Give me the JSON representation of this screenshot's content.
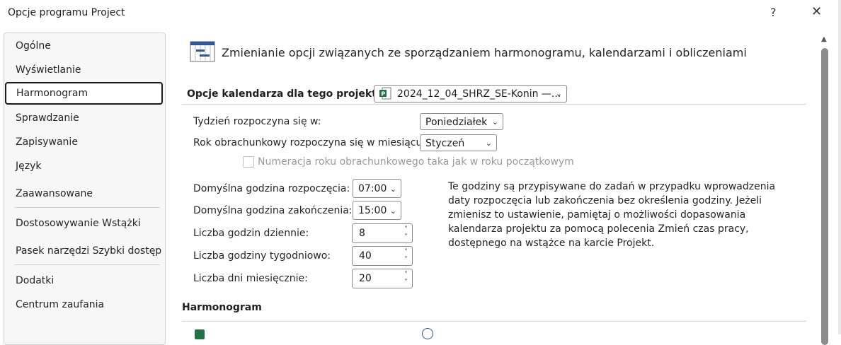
{
  "window": {
    "title": "Opcje programu Project",
    "help": "?",
    "close": "✕"
  },
  "nav": {
    "items": [
      "Ogólne",
      "Wyświetlanie",
      "Harmonogram",
      "Sprawdzanie",
      "Zapisywanie",
      "Język",
      "Zaawansowane",
      "Dostosowywanie Wstążki",
      "Pasek narzędzi Szybki dostęp",
      "Dodatki",
      "Centrum zaufania"
    ],
    "selected": "Harmonogram"
  },
  "main": {
    "heading": "Zmienianie opcji związanych ze sporządzaniem harmonogramu, kalendarzami i obliczeniami",
    "calendar_options": {
      "label": "Opcje kalendarza dla tego projektu:",
      "project_value": "2024_12_04_SHRZ_SE-Konin —...",
      "week_start_label": "Tydzień rozpoczyna się w:",
      "week_start_value": "Poniedziałek",
      "fiscal_year_label": "Rok obrachunkowy rozpoczyna się w miesiącu:",
      "fiscal_year_value": "Styczeń",
      "fiscal_numbering_label": "Numeracja roku obrachunkowego taka jak w roku początkowym",
      "start_time_label": "Domyślna godzina rozpoczęcia:",
      "start_time_value": "07:00",
      "end_time_label": "Domyślna godzina zakończenia:",
      "end_time_value": "15:00",
      "hours_per_day_label": "Liczba godzin dziennie:",
      "hours_per_day_value": "8",
      "hours_per_week_label": "Liczba godziny tygodniowo:",
      "hours_per_week_value": "40",
      "days_per_month_label": "Liczba dni miesięcznie:",
      "days_per_month_value": "20",
      "info_text": "Te godziny są przypisywane do zadań w przypadku wprowadzenia daty rozpoczęcia lub zakończenia bez określenia godziny. Jeżeli zmienisz to ustawienie, pamiętaj o możliwości dopasowania kalendarza projektu za pomocą polecenia Zmień czas pracy, dostępnego na wstążce na karcie Projekt."
    },
    "schedule_section": {
      "label": "Harmonogram"
    }
  },
  "colors": {
    "accent_green": "#217346",
    "selected_border": "#1a1a1a",
    "scroll_thumb": "#8c8c8c"
  }
}
